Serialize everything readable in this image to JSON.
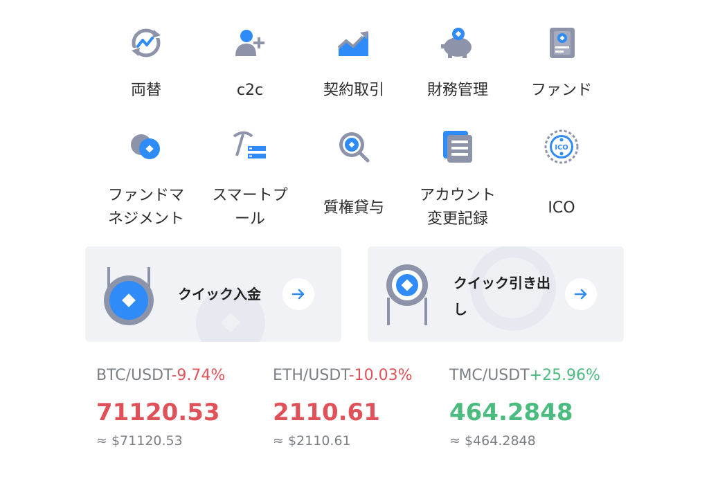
{
  "menu_row1": [
    {
      "label": "両替",
      "icon": "exchange-icon"
    },
    {
      "label": "c2c",
      "icon": "add-user-icon"
    },
    {
      "label": "契約取引",
      "icon": "contract-chart-icon"
    },
    {
      "label": "財務管理",
      "icon": "piggy-bank-icon"
    },
    {
      "label": "ファンド",
      "icon": "fund-book-icon"
    }
  ],
  "menu_row2": [
    {
      "label": "ファンドマ\nネジメント",
      "icon": "fund-management-icon"
    },
    {
      "label": "スマートプ\nール",
      "icon": "mining-pool-icon"
    },
    {
      "label": "質権貸与",
      "icon": "pledge-search-icon"
    },
    {
      "label": "アカウント\n変更記録",
      "icon": "account-record-icon"
    },
    {
      "label": "ICO",
      "icon": "ico-badge-icon"
    }
  ],
  "quick": {
    "deposit_label": "クイック入金",
    "withdraw_label": "クイック引き出\nし"
  },
  "tickers": [
    {
      "pair": "BTC/USDT",
      "change": "-9.74%",
      "price": "71120.53",
      "approx": "≈ $71120.53",
      "trend": "down"
    },
    {
      "pair": "ETH/USDT",
      "change": "-10.03%",
      "price": "2110.61",
      "approx": "≈ $2110.61",
      "trend": "down"
    },
    {
      "pair": "TMC/USDT",
      "change": "+25.96%",
      "price": "464.2848",
      "approx": "≈ $464.2848",
      "trend": "up"
    }
  ],
  "colors": {
    "accent": "#2e8bf7",
    "icon_gray": "#8d93a8",
    "down": "#e0525a",
    "up": "#4cbb7f",
    "card_bg": "#f0f2f6"
  }
}
